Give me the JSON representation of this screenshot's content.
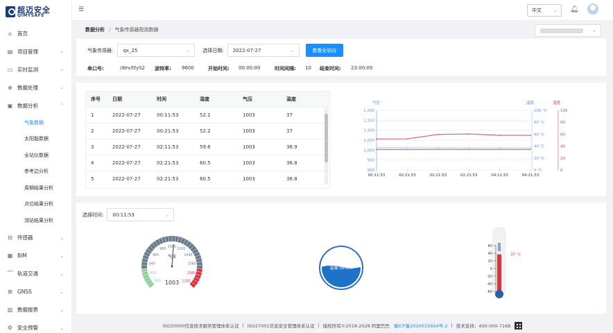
{
  "app": {
    "logo_cn": "超迈安全",
    "logo_en": "QIMYSAFE"
  },
  "sidebar": {
    "items": [
      {
        "label": "首页",
        "icon": "home-icon",
        "glyph": "⌂",
        "chev": ""
      },
      {
        "label": "项目管理",
        "icon": "project-icon",
        "glyph": "▤",
        "chev": "⌄"
      },
      {
        "label": "实时监测",
        "icon": "monitor-icon",
        "glyph": "▭",
        "chev": "⌄"
      },
      {
        "label": "数据处理",
        "icon": "process-icon",
        "glyph": "⊕",
        "chev": "⌄"
      },
      {
        "label": "数据分析",
        "icon": "analysis-icon",
        "glyph": "▣",
        "chev": "⌃"
      }
    ],
    "subitems": [
      "气象数据",
      "太阳能数据",
      "全站仪数据",
      "参考边分析",
      "周期结果分析",
      "点位结果分析",
      "测站结果分析"
    ],
    "items2": [
      {
        "label": "传感器",
        "icon": "sensor-icon",
        "glyph": "⊟",
        "chev": "⌄"
      },
      {
        "label": "BIM",
        "icon": "bim-icon",
        "glyph": "▦",
        "chev": "⌄"
      },
      {
        "label": "轨道交通",
        "icon": "rail-icon",
        "glyph": "⌒",
        "chev": "⌄"
      },
      {
        "label": "GNSS",
        "icon": "gnss-icon",
        "glyph": "⊞",
        "chev": "⌄"
      },
      {
        "label": "数据报表",
        "icon": "report-icon",
        "glyph": "▥",
        "chev": "⌄"
      },
      {
        "label": "安全预警",
        "icon": "alarm-icon",
        "glyph": "⚙",
        "chev": "⌄"
      }
    ]
  },
  "topbar": {
    "lang": "中文"
  },
  "breadcrumb": {
    "root": "数据分析",
    "separator": "/",
    "current": "气象传感器观测数据"
  },
  "filter": {
    "sensor_label": "气象传感器:",
    "sensor_value": "qx_25",
    "date_label": "选择日期:",
    "date_value": "2022-07-27",
    "button": "查看全站仪"
  },
  "info": {
    "port_k": "串口号:",
    "port_v": "/dev/ttyS2",
    "baud_k": "波特率:",
    "baud_v": "9600",
    "start_k": "开始时间:",
    "start_v": "00:00:00",
    "interval_k": "时间间隔:",
    "interval_v": "10",
    "end_k": "结束时间:",
    "end_v": "23:00:00"
  },
  "table": {
    "headers": [
      "序号",
      "日期",
      "时间",
      "湿度",
      "气压",
      "温度"
    ],
    "rows": [
      [
        "1",
        "2022-07-27",
        "00:11:53",
        "52.1",
        "1003",
        "37"
      ],
      [
        "2",
        "2022-07-27",
        "00:21:53",
        "52.2",
        "1003",
        "37"
      ],
      [
        "3",
        "2022-07-27",
        "02:11:53",
        "59.6",
        "1003",
        "36.9"
      ],
      [
        "4",
        "2022-07-27",
        "02:21:53",
        "60.5",
        "1003",
        "36.8"
      ],
      [
        "5",
        "2022-07-27",
        "02:21:53",
        "60.5",
        "1003",
        "36.8"
      ]
    ]
  },
  "chart_data": {
    "type": "line",
    "x": [
      "00:11:53",
      "00:21:53",
      "02:11:53",
      "02:21:53",
      "04:11:53",
      "04:21:53"
    ],
    "series": [
      {
        "name": "气压",
        "axis": "left",
        "color": "#5b8ff9",
        "values": [
          1003,
          1003,
          1003,
          1003,
          1003,
          1003
        ]
      },
      {
        "name": "温度",
        "axis": "right1",
        "color": "#9db7f5",
        "values": [
          37,
          37,
          36.9,
          36.8,
          36.8,
          36.8
        ]
      },
      {
        "name": "湿度",
        "axis": "right2",
        "color": "#d9485a",
        "values": [
          52.1,
          52.2,
          59.6,
          60.5,
          58,
          58
        ]
      }
    ],
    "left_axis": {
      "title": "气压",
      "ylim": [
        900,
        1200
      ],
      "ticks": [
        "900",
        "950",
        "1,000",
        "1,050",
        "1,100",
        "1,150",
        "1,200"
      ]
    },
    "right_axis1": {
      "title": "温度",
      "ylim": [
        0,
        100
      ],
      "ticks": [
        "0 °C",
        "20 °C",
        "40 °C",
        "60 °C",
        "80 °C",
        "100 °C"
      ]
    },
    "right_axis2": {
      "title": "湿度",
      "ylim": [
        0,
        100
      ],
      "ticks": [
        "0",
        "20",
        "40",
        "60",
        "80",
        "100"
      ]
    },
    "grid": true
  },
  "time_filter": {
    "label": "选择时间:",
    "value": "00:11:53"
  },
  "gauge": {
    "title": "气压",
    "value": 1003,
    "min": 900,
    "max": 1100,
    "tick_labels": [
      "900",
      "920",
      "940",
      "960",
      "980",
      "1000",
      "1020",
      "1040",
      "1060",
      "1080",
      "1100"
    ]
  },
  "humidity_ball": {
    "label": "湿度:52.1%",
    "value": 52.1
  },
  "thermometer": {
    "value": 37,
    "value_label": "37 °C",
    "min": -60,
    "max": 60,
    "ticks": [
      "60",
      "40",
      "20",
      "0",
      "-20",
      "-40",
      "-60"
    ]
  },
  "footer": {
    "text1": "ISO20000信息技术服务管理体系认证",
    "text2": "ISO27001信息安全管理体系认证",
    "text3": "版权所有©2018-2028 阿里巴巴",
    "icp": "蜀ICP备2020015604号-2",
    "support": "技术支持：400-000-7168",
    "sep": "|"
  }
}
